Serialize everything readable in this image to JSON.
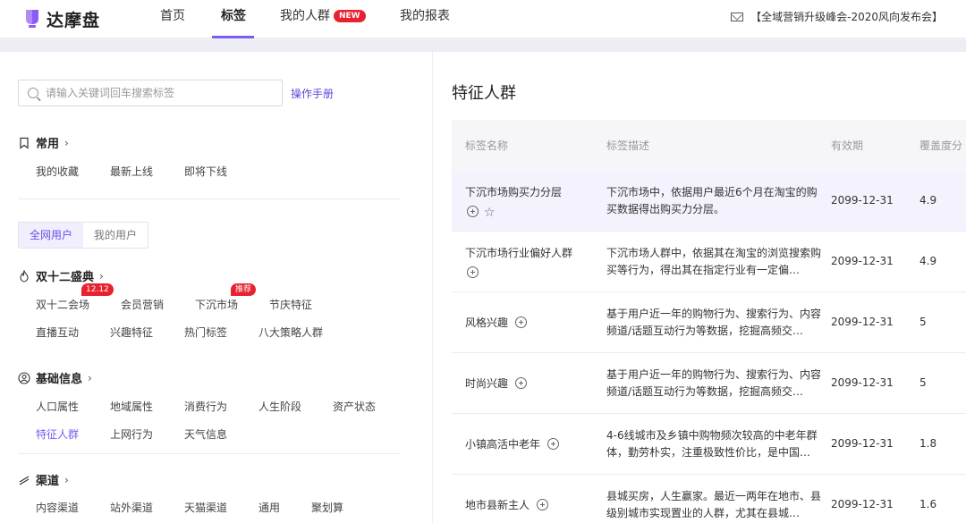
{
  "nav": {
    "logo_text": "达摩盘",
    "items": [
      {
        "label": "首页"
      },
      {
        "label": "标签"
      },
      {
        "label": "我的人群",
        "badge": "NEW"
      },
      {
        "label": "我的报表"
      }
    ],
    "announcement": "【全域营销升级峰会-2020风向发布会】"
  },
  "left": {
    "search_placeholder": "请输入关键词回车搜索标签",
    "manual_link": "操作手册",
    "common": {
      "title": "常用",
      "items": [
        "我的收藏",
        "最新上线",
        "即将下线"
      ]
    },
    "segment": [
      "全网用户",
      "我的用户"
    ],
    "double12": {
      "title": "双十二盛典",
      "items": [
        "双十二会场",
        "会员营销",
        "下沉市场",
        "节庆特征",
        "直播互动",
        "兴趣特征",
        "热门标签",
        "八大策略人群"
      ],
      "badge_date": "12.12",
      "badge_recommend": "推荐"
    },
    "basic": {
      "title": "基础信息",
      "items": [
        "人口属性",
        "地域属性",
        "消费行为",
        "人生阶段",
        "资产状态",
        "特征人群",
        "上网行为",
        "天气信息"
      ]
    },
    "channel": {
      "title": "渠道",
      "items": [
        "内容渠道",
        "站外渠道",
        "天猫渠道",
        "通用",
        "聚划算"
      ]
    }
  },
  "right": {
    "title": "特征人群",
    "columns": [
      "标签名称",
      "标签描述",
      "有效期",
      "覆盖度分"
    ],
    "rows": [
      {
        "name": "下沉市场购买力分层",
        "desc": "下沉市场中，依据用户最近6个月在淘宝的购买数据得出购买力分层。",
        "date": "2099-12-31",
        "cov": "4.9"
      },
      {
        "name": "下沉市场行业偏好人群",
        "desc": "下沉市场人群中，依据其在淘宝的浏览搜索购买等行为，得出其在指定行业有一定偏…",
        "date": "2099-12-31",
        "cov": "4.9"
      },
      {
        "name": "风格兴趣",
        "desc": "基于用户近一年的购物行为、搜索行为、内容频道/话题互动行为等数据，挖掘高频交…",
        "date": "2099-12-31",
        "cov": "5"
      },
      {
        "name": "时尚兴趣",
        "desc": "基于用户近一年的购物行为、搜索行为、内容频道/话题互动行为等数据，挖掘高频交…",
        "date": "2099-12-31",
        "cov": "5"
      },
      {
        "name": "小镇高活中老年",
        "desc": "4-6线城市及乡镇中购物频次较高的中老年群体，勤劳朴实，注重极致性价比，是中国…",
        "date": "2099-12-31",
        "cov": "1.8"
      },
      {
        "name": "地市县新主人",
        "desc": "县城买房，人生赢家。最近一两年在地市、县级别城市实现置业的人群，尤其在县城…",
        "date": "2099-12-31",
        "cov": "1.6"
      }
    ]
  },
  "colors": {
    "accent": "#7b5cf5",
    "badge_red": "#e8212f"
  }
}
